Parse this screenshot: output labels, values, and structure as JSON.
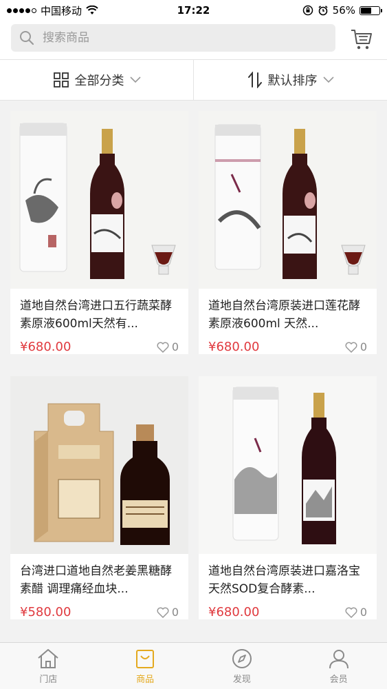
{
  "status_bar": {
    "carrier": "中国移动",
    "time": "17:22",
    "battery": "56%",
    "battery_level": 0.56
  },
  "search": {
    "placeholder": "搜索商品",
    "icon": "search-icon",
    "cart_icon": "cart-icon"
  },
  "filters": {
    "category_label": "全部分类",
    "sort_label": "默认排序"
  },
  "products": [
    {
      "title": "道地自然台湾进口五行蔬菜酵素原液600ml天然有...",
      "price": "¥680.00",
      "likes": "0"
    },
    {
      "title": "道地自然台湾原装进口莲花酵素原液600ml 天然...",
      "price": "¥680.00",
      "likes": "0"
    },
    {
      "title": "台湾进口道地自然老姜黑糖酵素醋 调理痛经血块...",
      "price": "¥580.00",
      "likes": "0"
    },
    {
      "title": "道地自然台湾原装进口嘉洛宝天然SOD复合酵素...",
      "price": "¥680.00",
      "likes": "0"
    }
  ],
  "tabs": [
    {
      "label": "门店",
      "icon": "home-icon"
    },
    {
      "label": "商品",
      "icon": "bag-icon"
    },
    {
      "label": "发现",
      "icon": "compass-icon"
    },
    {
      "label": "会员",
      "icon": "user-icon"
    }
  ],
  "colors": {
    "accent": "#e4a91e",
    "price": "#e0393e",
    "background": "#f2f2f2"
  }
}
